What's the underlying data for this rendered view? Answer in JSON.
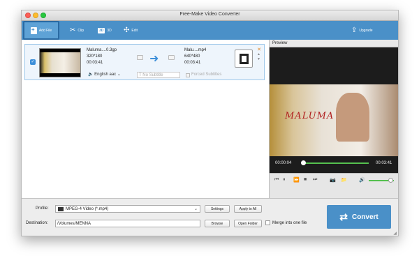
{
  "window": {
    "title": "Free-Make Video Converter"
  },
  "toolbar": {
    "add_file": "Add File",
    "clip": "Clip",
    "three_d_badge": "3D",
    "three_d": "3D",
    "edit": "Edit",
    "upgrade": "Upgrade"
  },
  "file": {
    "source_name": "Maluma....0.3gp",
    "source_resolution": "320*180",
    "source_duration": "00:03:41",
    "output_name": "Malu....mp4",
    "output_resolution": "640*480",
    "output_duration": "00:03:41",
    "audio_track": "English aac",
    "subtitle": "No Subtitle",
    "forced_subtitles": "Forced Subtitles"
  },
  "preview": {
    "label": "Preview",
    "overlay_text": "MALUMA",
    "time_current": "00:00:04",
    "time_total": "00:03:41",
    "playback_progress": 0.02,
    "volume_level": 0.85
  },
  "bottom": {
    "profile_label": "Profile:",
    "profile_value": "MPEG-4 Video (*.mp4)",
    "settings_button": "Settings",
    "apply_all_button": "Apply to All",
    "destination_label": "Destination:",
    "destination_value": "/Volumes/MENNA",
    "browse_button": "Browse",
    "open_folder_button": "Open Folder",
    "merge_label": "Merge into one file",
    "convert_button": "Convert"
  },
  "colors": {
    "toolbar_blue": "#4a90c8",
    "progress_green": "#55c04f",
    "close_orange": "#e0892a"
  }
}
